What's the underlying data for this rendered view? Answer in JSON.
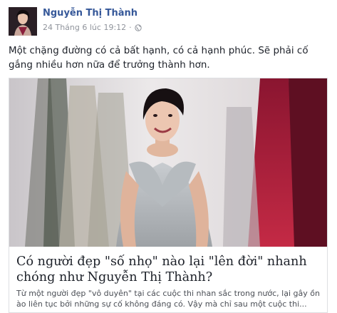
{
  "post": {
    "author": "Nguyễn Thị Thành",
    "timestamp": "24 Tháng 6 lúc 19:12",
    "separator": "·",
    "privacy_icon": "globe-icon",
    "status_text": "Một chặng đường có cả bất hạnh, có cả hạnh phúc. Sẽ phải cố gắng nhiều hơn nữa để trưởng thành hơn."
  },
  "link_card": {
    "title": "Có người đẹp \"số nhọ\" nào lại \"lên đời\" nhanh chóng như Nguyễn Thị Thành?",
    "description": "Từ một người đẹp \"vô duyên\" tại các cuộc thi nhan sắc trong nước, lại gây ồn ào liên tục bởi những sự cố không đáng có. Vậy mà chỉ sau một cuộc thi...",
    "image_alt": "photo of woman in sparkling gown"
  },
  "colors": {
    "author_link": "#365899",
    "meta_text": "#90949c",
    "body_text": "#1d2129",
    "card_border": "#dddfe2"
  }
}
